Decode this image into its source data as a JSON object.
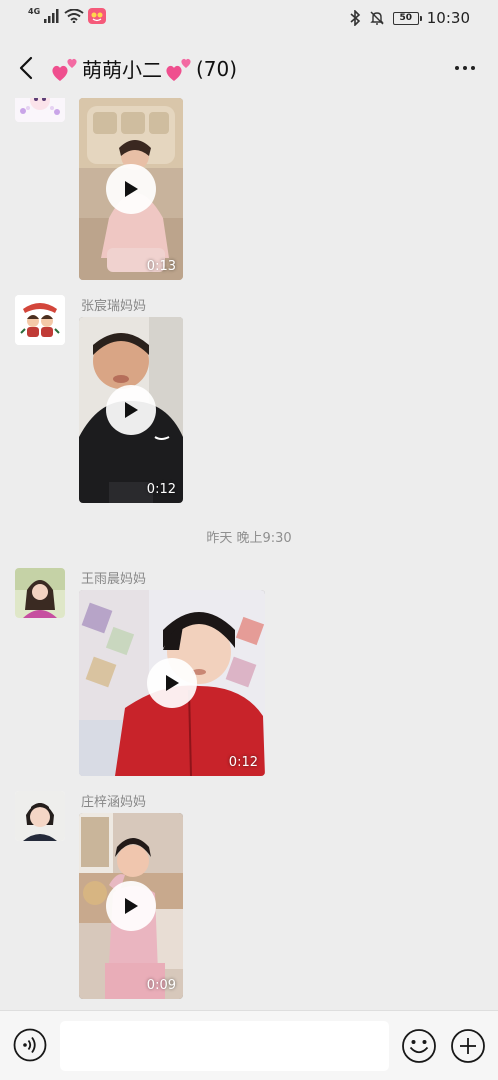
{
  "status_bar": {
    "network": "4G",
    "time": "10:30",
    "battery": "50"
  },
  "header": {
    "title": "萌萌小二",
    "member_count": "(70)"
  },
  "messages": [
    {
      "sender": "",
      "duration": "0:13"
    },
    {
      "sender": "张宸瑞妈妈",
      "duration": "0:12"
    },
    {
      "sender": "王雨晨妈妈",
      "duration": "0:12"
    },
    {
      "sender": "庄梓涵妈妈",
      "duration": "0:09"
    }
  ],
  "timestamp": "昨天 晚上9:30",
  "input": {
    "value": "",
    "placeholder": ""
  }
}
